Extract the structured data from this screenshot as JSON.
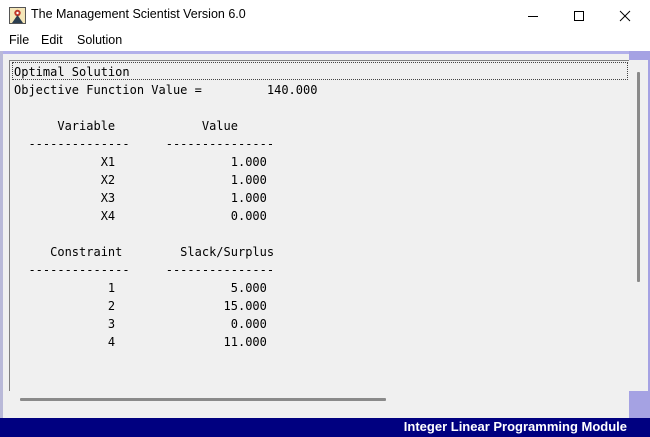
{
  "window": {
    "title": "The Management Scientist Version 6.0",
    "icon": "app-icon"
  },
  "menu": [
    "File",
    "Edit",
    "Solution"
  ],
  "report": {
    "heading": "Optimal Solution",
    "objective_label": "Objective Function Value =",
    "objective_value": "140.000",
    "variables_header": [
      "Variable",
      "Value"
    ],
    "variables": [
      {
        "name": "X1",
        "value": "1.000"
      },
      {
        "name": "X2",
        "value": "1.000"
      },
      {
        "name": "X3",
        "value": "1.000"
      },
      {
        "name": "X4",
        "value": "0.000"
      }
    ],
    "constraints_header": [
      "Constraint",
      "Slack/Surplus"
    ],
    "constraints": [
      {
        "name": "1",
        "value": "5.000"
      },
      {
        "name": "2",
        "value": "15.000"
      },
      {
        "name": "3",
        "value": "0.000"
      },
      {
        "name": "4",
        "value": "11.000"
      }
    ]
  },
  "status": "Integer Linear Programming Module",
  "colors": {
    "status_bar": "#000080",
    "frame": "#a5a2e3",
    "client": "#f0f0f0"
  }
}
